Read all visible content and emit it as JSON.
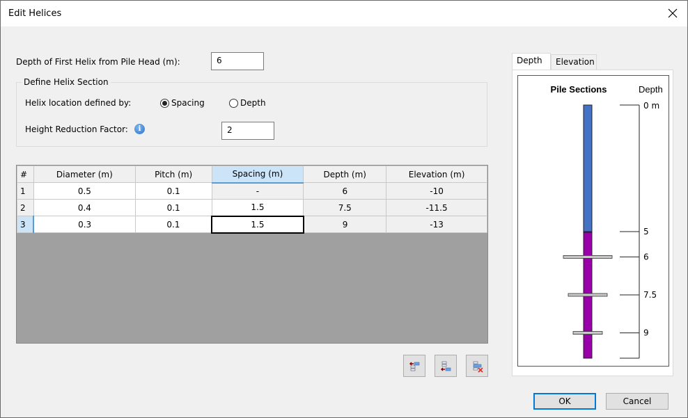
{
  "window": {
    "title": "Edit Helices",
    "close_icon": "close-icon"
  },
  "first_helix": {
    "label": "Depth of First Helix from Pile Head (m):",
    "value": "6"
  },
  "helix_section": {
    "title": "Define Helix Section",
    "location_label": "Helix location defined by:",
    "options": [
      {
        "label": "Spacing",
        "selected": true
      },
      {
        "label": "Depth",
        "selected": false
      }
    ],
    "reduction_label": "Height Reduction Factor:",
    "reduction_value": "2",
    "info_icon": "info-icon"
  },
  "table": {
    "columns": [
      "#",
      "Diameter (m)",
      "Pitch (m)",
      "Spacing (m)",
      "Depth (m)",
      "Elevation (m)"
    ],
    "selected_column": 3,
    "rows": [
      {
        "num": "1",
        "diameter": "0.5",
        "pitch": "0.1",
        "spacing": "-",
        "depth": "6",
        "elevation": "-10"
      },
      {
        "num": "2",
        "diameter": "0.4",
        "pitch": "0.1",
        "spacing": "1.5",
        "depth": "7.5",
        "elevation": "-11.5"
      },
      {
        "num": "3",
        "diameter": "0.3",
        "pitch": "0.1",
        "spacing": "1.5",
        "depth": "9",
        "elevation": "-13"
      }
    ],
    "selected_row": 3
  },
  "table_actions": [
    {
      "name": "insert-row-above-button",
      "icon": "insert-row-above-icon"
    },
    {
      "name": "insert-row-below-button",
      "icon": "insert-row-below-icon"
    },
    {
      "name": "delete-row-button",
      "icon": "delete-row-icon"
    }
  ],
  "preview": {
    "tabs": [
      {
        "label": "Depth",
        "active": true
      },
      {
        "label": "Elevation",
        "active": false
      }
    ],
    "title": "Pile Sections",
    "axis_title": "Depth",
    "axis_ticks": [
      "0 m",
      "5",
      "6",
      "7.5",
      "9"
    ],
    "sections": [
      {
        "from": 0,
        "to": 5,
        "color": "#4472c4"
      },
      {
        "from": 5,
        "to": 10,
        "color": "#9900aa"
      }
    ],
    "helices": [
      {
        "depth": 6,
        "diameter": 0.5
      },
      {
        "depth": 7.5,
        "diameter": 0.4
      },
      {
        "depth": 9,
        "diameter": 0.3
      }
    ],
    "axis_max": 10
  },
  "buttons": {
    "ok": "OK",
    "cancel": "Cancel"
  }
}
